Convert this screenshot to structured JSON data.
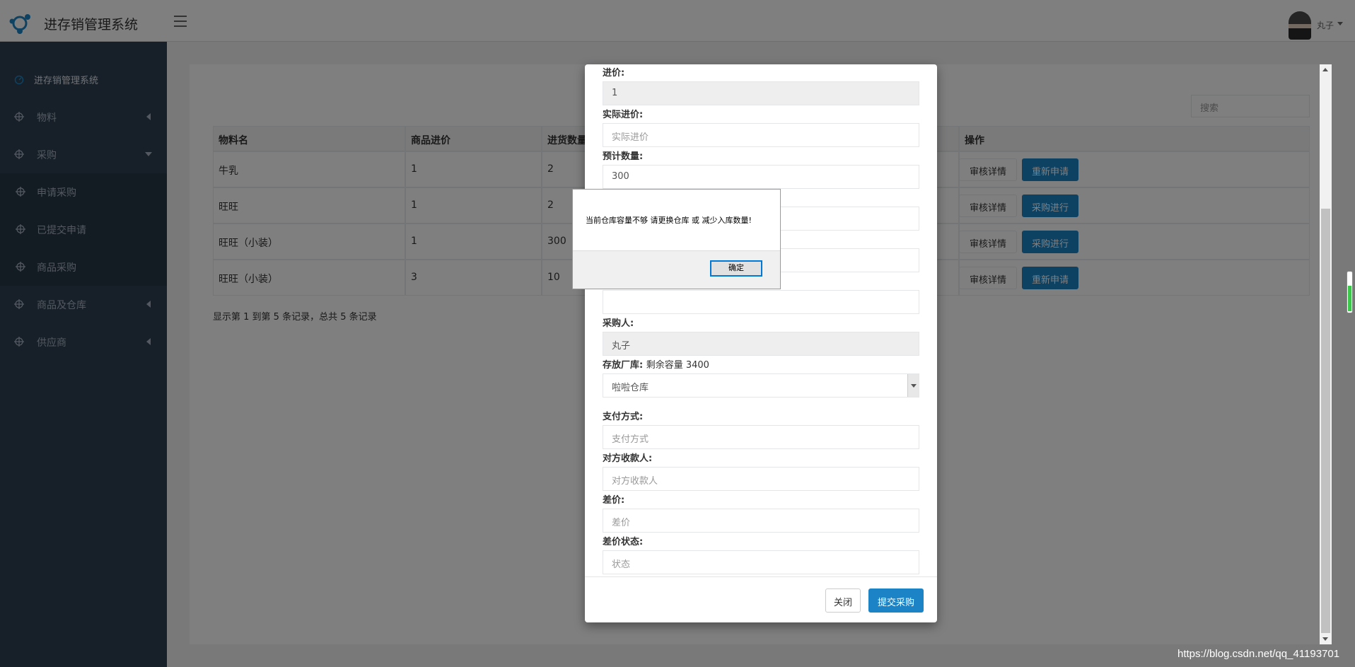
{
  "app": {
    "title": "进存销管理系统"
  },
  "header": {
    "user_name": "丸子"
  },
  "sidebar": {
    "items": [
      {
        "label": "进存销管理系统"
      },
      {
        "label": "物料"
      },
      {
        "label": "采购"
      },
      {
        "label": "申请采购"
      },
      {
        "label": "已提交申请"
      },
      {
        "label": "商品采购"
      },
      {
        "label": "商品及仓库"
      },
      {
        "label": "供应商"
      }
    ]
  },
  "search": {
    "placeholder": "搜索"
  },
  "table": {
    "headers": [
      "物料名",
      "商品进价",
      "进货数量",
      "操作"
    ],
    "rows": [
      {
        "name": "牛乳",
        "price": "1",
        "qty": "2",
        "detail": "审核详情",
        "action": "重新申请"
      },
      {
        "name": "旺旺",
        "price": "1",
        "qty": "2",
        "detail": "审核详情",
        "action": "采购进行"
      },
      {
        "name": "旺旺（小装）",
        "price": "1",
        "qty": "300",
        "detail": "审核详情",
        "action": "采购进行"
      },
      {
        "name": "旺旺（小装）",
        "price": "3",
        "qty": "10",
        "detail": "审核详情",
        "action": "重新申请"
      }
    ]
  },
  "pagination": {
    "text": "显示第 1 到第 5 条记录，总共 5 条记录"
  },
  "modal": {
    "fields": {
      "price_label": "进价:",
      "price_value": "1",
      "actual_price_label": "实际进价:",
      "actual_price_placeholder": "实际进价",
      "est_qty_label": "预计数量:",
      "est_qty_value": "300",
      "buyer_label": "采购人:",
      "buyer_value": "丸子",
      "warehouse_label": "存放厂库:",
      "warehouse_note": "剩余容量 3400",
      "warehouse_value": "啦啦仓库",
      "payment_label": "支付方式:",
      "payment_placeholder": "支付方式",
      "payee_label": "对方收款人:",
      "payee_placeholder": "对方收款人",
      "diff_label": "差价:",
      "diff_placeholder": "差价",
      "diff_status_label": "差价状态:",
      "diff_status_placeholder": "状态"
    },
    "close_label": "关闭",
    "submit_label": "提交采购"
  },
  "alert": {
    "message": "当前仓库容量不够 请更换仓库 或 减少入库数量!",
    "ok_label": "确定"
  },
  "watermark": "https://blog.csdn.net/qq_41193701",
  "colors": {
    "sidebar_bg": "#2f4050",
    "primary": "#1c84c6"
  },
  "icons": {
    "logo": "molecule-logo-icon",
    "menu": "hamburger-icon",
    "nav": "crosshair-icon",
    "dashboard": "gauge-icon"
  }
}
